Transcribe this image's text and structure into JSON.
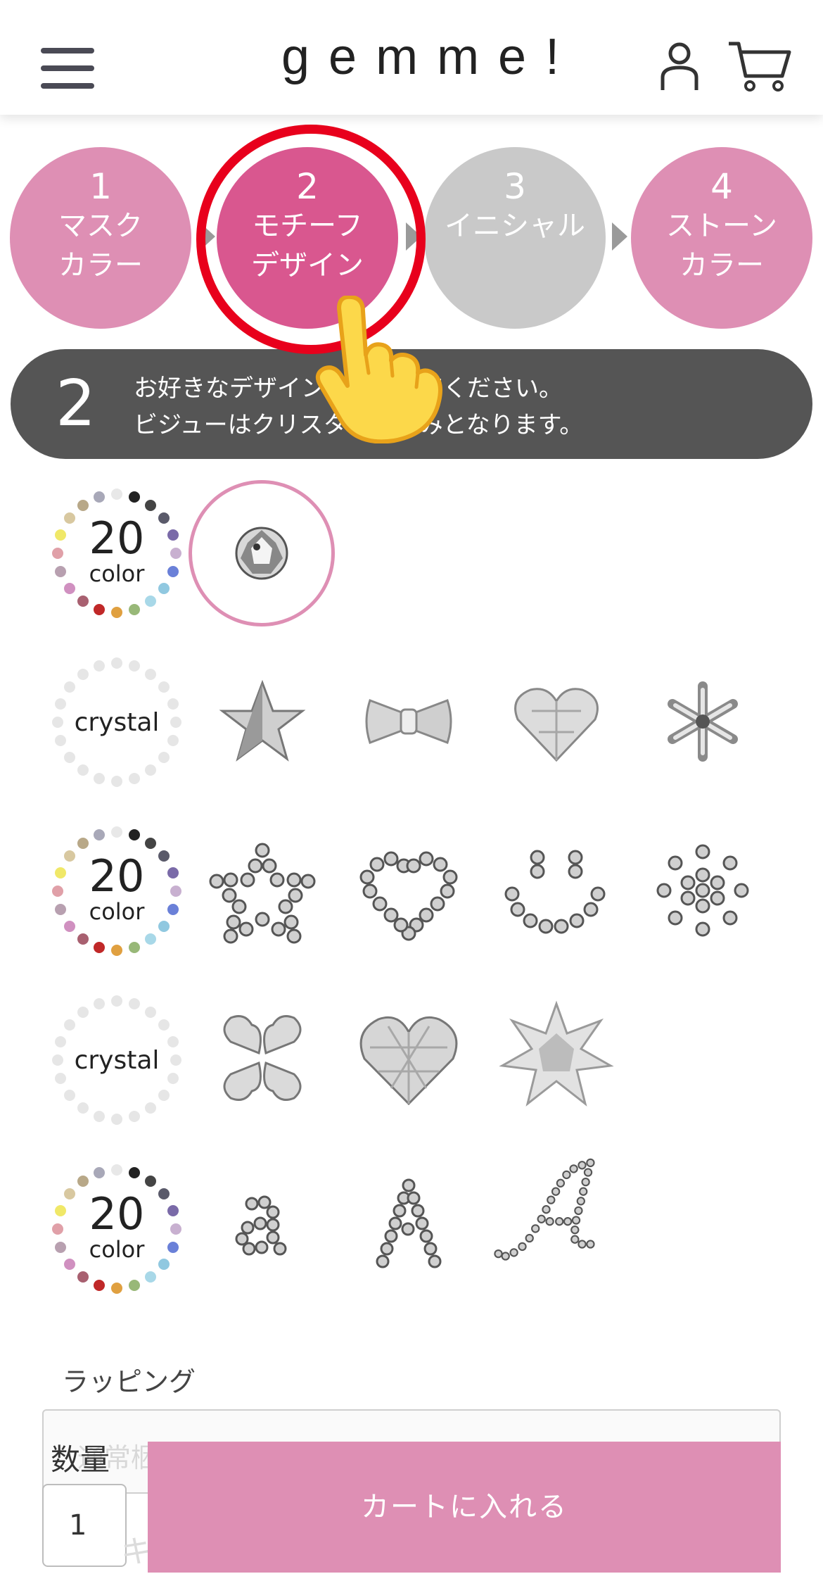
{
  "header": {
    "logo": "gemme!",
    "menu_icon": "hamburger-menu-icon",
    "user_icon": "user-icon",
    "cart_icon": "cart-icon"
  },
  "steps": [
    {
      "number": "1",
      "line1": "マスク",
      "line2": "カラー",
      "state": "default"
    },
    {
      "number": "2",
      "line1": "モチーフ",
      "line2": "デザイン",
      "state": "active"
    },
    {
      "number": "3",
      "line1": "イニシャル",
      "line2": "",
      "state": "disabled"
    },
    {
      "number": "4",
      "line1": "ストーン",
      "line2": "カラー",
      "state": "default"
    }
  ],
  "instruction": {
    "number": "2",
    "line1": "お好きなデザイン　　　してください。",
    "line2": "ビジューはクリスタ　　のみとなります。"
  },
  "badges": [
    {
      "type": "20color",
      "big": "20",
      "small": "color"
    },
    {
      "type": "crystal",
      "label": "crystal"
    },
    {
      "type": "20color",
      "big": "20",
      "small": "color"
    },
    {
      "type": "crystal",
      "label": "crystal"
    },
    {
      "type": "20color",
      "big": "20",
      "small": "color"
    }
  ],
  "motifs": [
    [
      "single-stone"
    ],
    [
      "star-stone",
      "ribbon-stone",
      "heart-stone",
      "snowflake-stone"
    ],
    [
      "star-outline-rhinestones",
      "heart-outline-rhinestones",
      "smiley-rhinestones",
      "flower-rhinestones"
    ],
    [
      "clover-stones",
      "large-heart-stone",
      "edelweiss-stone"
    ],
    [
      "small-letter-a-rhinestones",
      "letter-a-rhinestones",
      "script-letter-a-rhinestones"
    ]
  ],
  "selected_motif": "single-stone",
  "wrapping": {
    "label": "ラッピング",
    "placeholder": "通常梱包"
  },
  "quantity": {
    "label": "数量",
    "value": "1"
  },
  "ghost_text": "キ",
  "cart_button": "カートに入れる",
  "colors": {
    "pink": "#de8fb4",
    "active_pink": "#d9578f",
    "disabled": "#c9c9c9",
    "instruction_bg": "#555555",
    "highlight_ring": "#e8001c"
  }
}
